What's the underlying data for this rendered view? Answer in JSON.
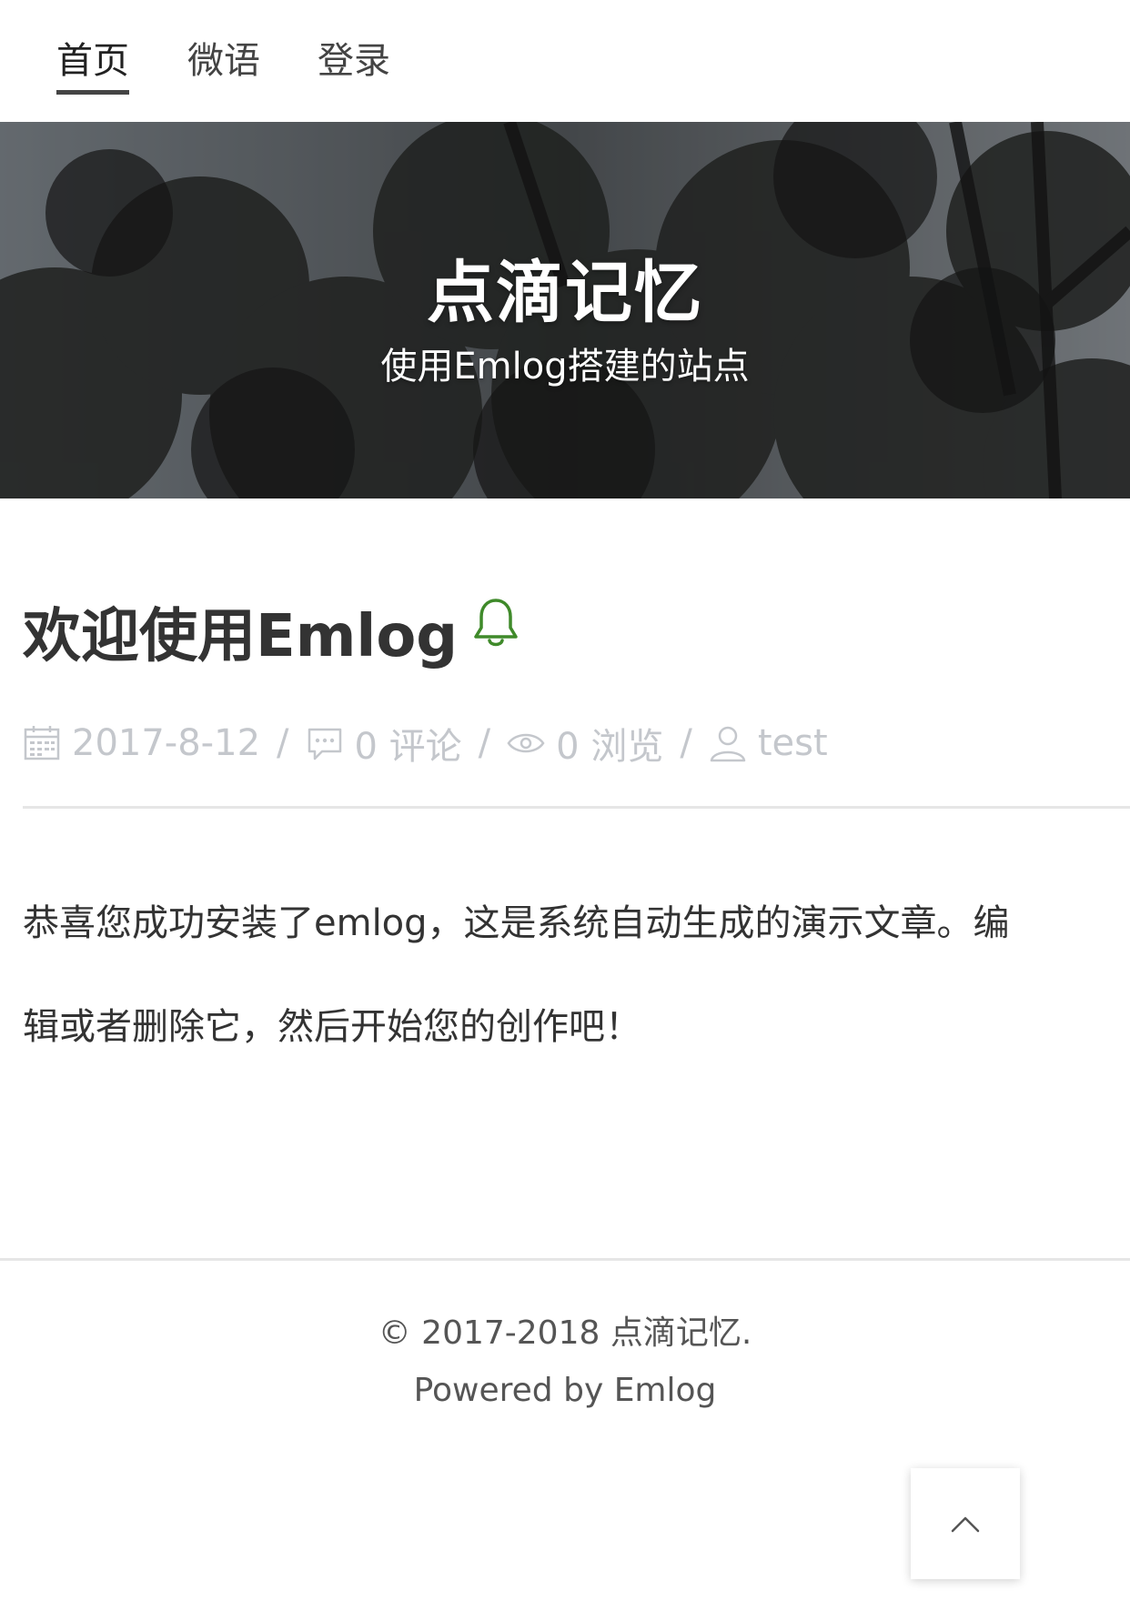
{
  "nav": {
    "items": [
      {
        "label": "首页",
        "active": true
      },
      {
        "label": "微语",
        "active": false
      },
      {
        "label": "登录",
        "active": false
      }
    ]
  },
  "hero": {
    "title": "点滴记忆",
    "subtitle": "使用Emlog搭建的站点"
  },
  "post": {
    "title": "欢迎使用Emlog",
    "title_icon": "bell-icon",
    "meta": {
      "date": "2017-8-12",
      "comments": "0 评论",
      "views": "0 浏览",
      "author": "test",
      "separator": "/"
    },
    "body_line1": "恭喜您成功安装了emlog，这是系统自动生成的演示文章。编",
    "body_line2": "辑或者删除它，然后开始您的创作吧！"
  },
  "footer": {
    "copyright": "© 2017-2018 点滴记忆.",
    "powered_by": "Powered by Emlog"
  },
  "back_to_top": {
    "icon": "chevron-up-icon"
  },
  "colors": {
    "accent_bell": "#3f8a2a",
    "meta_text": "#c4c7cc",
    "body_text": "#333333",
    "hero_bg": "#3b3b3b"
  }
}
